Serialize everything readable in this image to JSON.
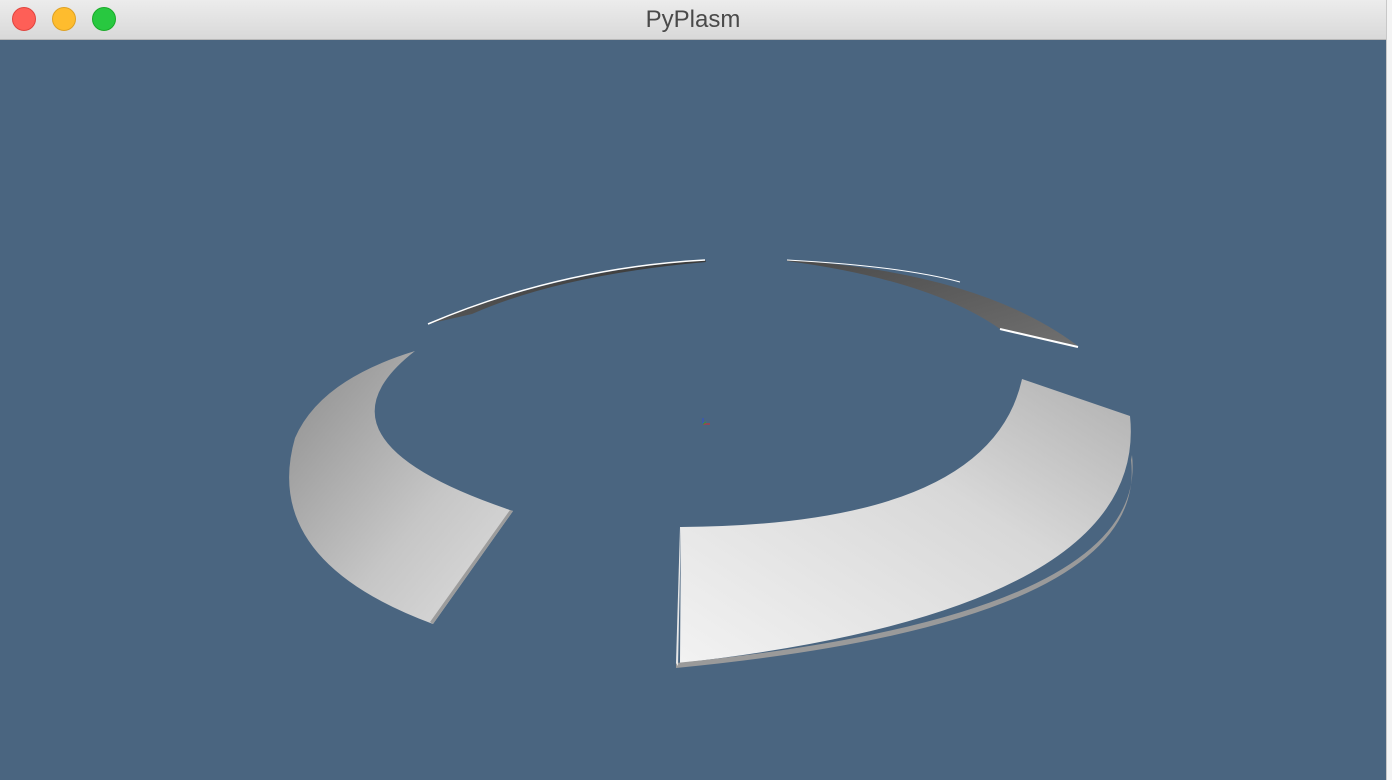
{
  "window": {
    "title": "PyPlasm"
  },
  "colors": {
    "viewport_background": "#4a6580",
    "surface_light": "#f0f0f0",
    "surface_dark": "#8e8e8e",
    "close": "#fe5f57",
    "minimize": "#febc2e",
    "zoom": "#28c840"
  },
  "icons": {
    "close": "close-window-icon",
    "minimize": "minimize-window-icon",
    "zoom": "zoom-window-icon",
    "axes": "axes-origin-icon"
  }
}
